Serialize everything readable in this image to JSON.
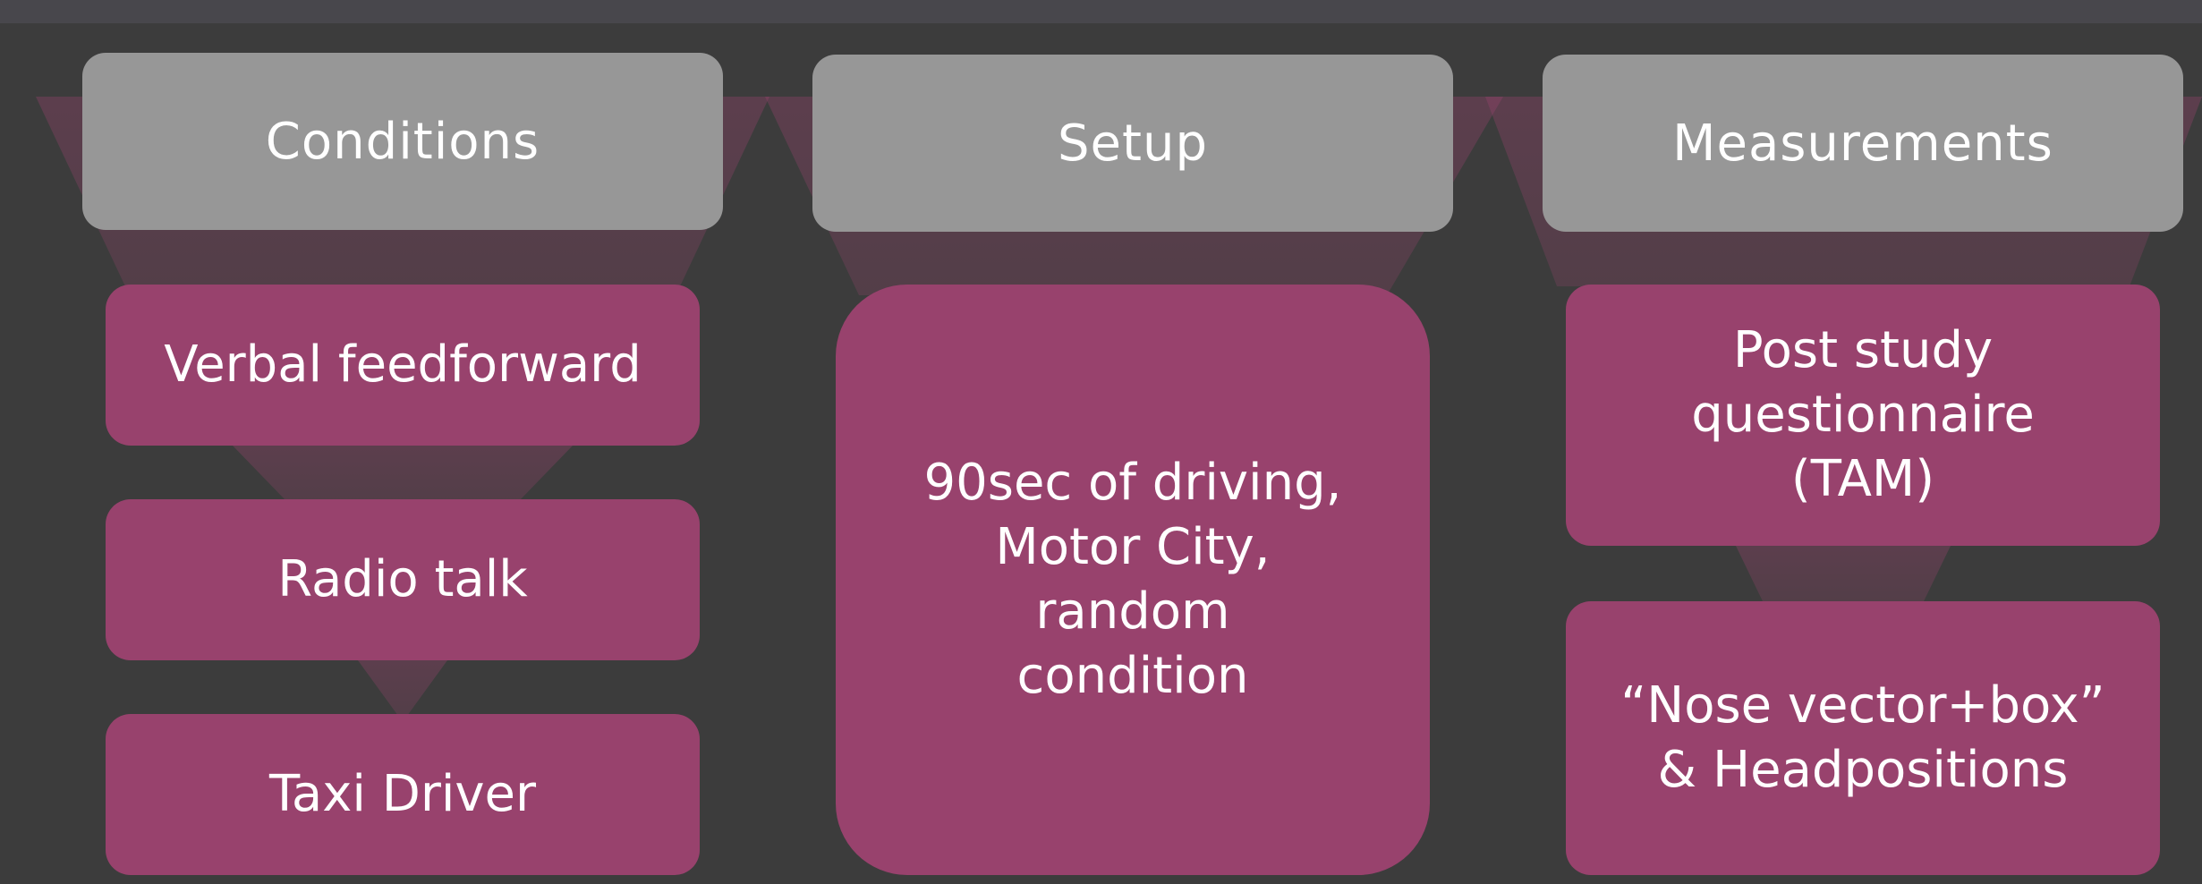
{
  "columns": [
    {
      "header": "Conditions",
      "items": [
        "Verbal feedforward",
        "Radio talk",
        "Taxi Driver"
      ]
    },
    {
      "header": "Setup",
      "items": [
        "90sec of driving,\nMotor City,\nrandom\ncondition"
      ]
    },
    {
      "header": "Measurements",
      "items": [
        "Post study\nquestionnaire\n(TAM)",
        "“Nose vector+box”\n& Headpositions"
      ]
    }
  ],
  "colors": {
    "background": "#3c3c3c",
    "header": "#979797",
    "box": "#98426d"
  }
}
